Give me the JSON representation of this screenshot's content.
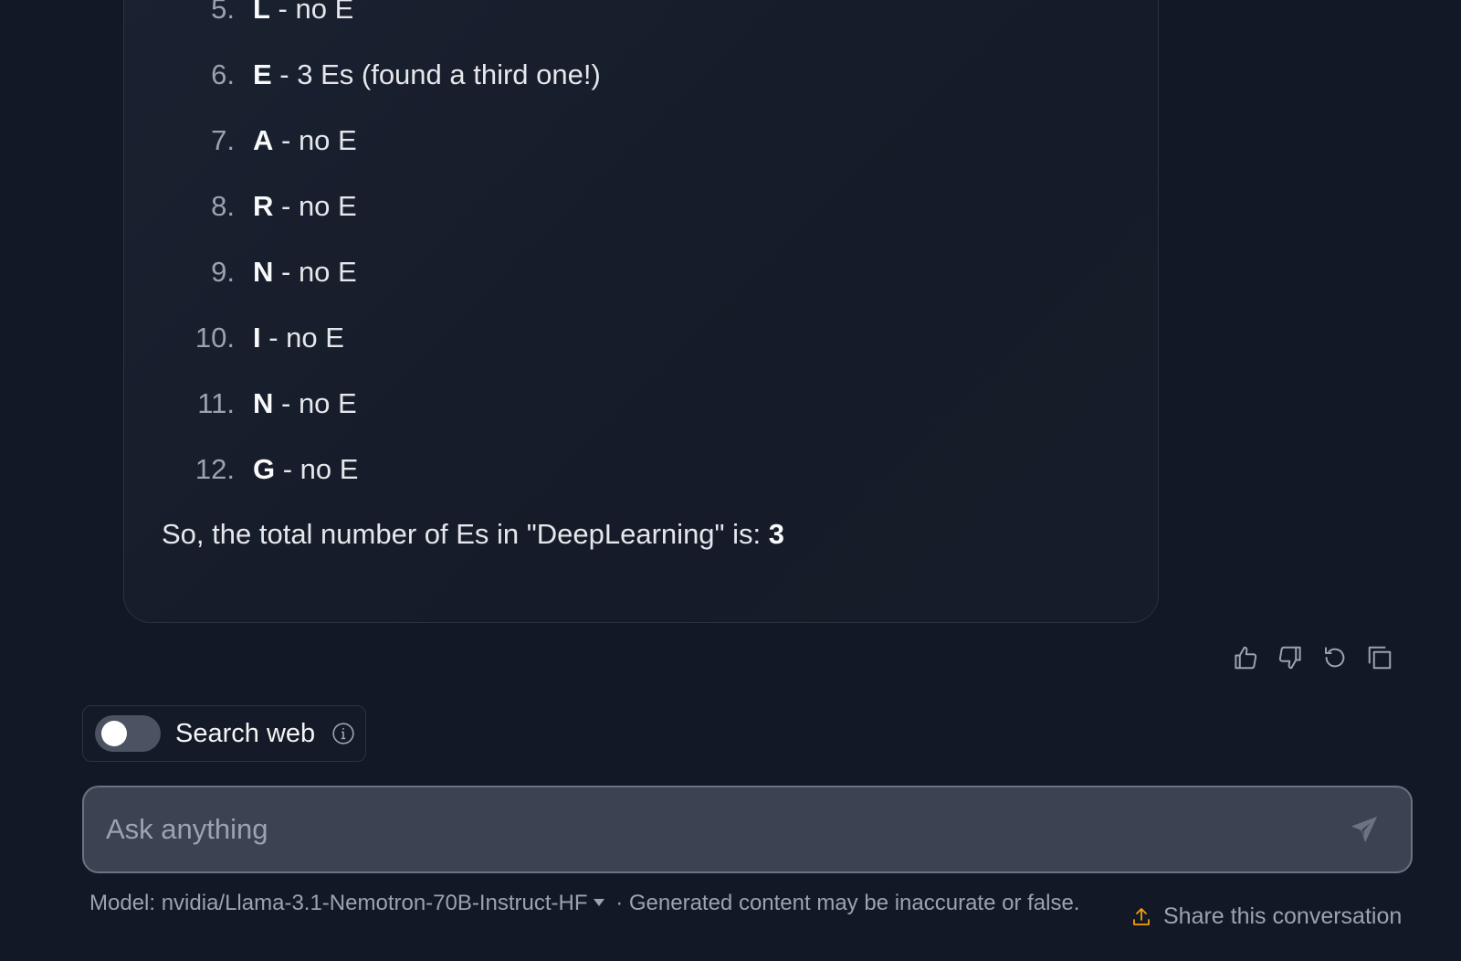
{
  "message": {
    "steps": [
      {
        "num": "5.",
        "letter": "L",
        "text": " - no E"
      },
      {
        "num": "6.",
        "letter": "E",
        "text": " - 3 Es (found a third one!)"
      },
      {
        "num": "7.",
        "letter": "A",
        "text": " - no E"
      },
      {
        "num": "8.",
        "letter": "R",
        "text": " - no E"
      },
      {
        "num": "9.",
        "letter": "N",
        "text": " - no E"
      },
      {
        "num": "10.",
        "letter": "I",
        "text": " - no E"
      },
      {
        "num": "11.",
        "letter": "N",
        "text": " - no E"
      },
      {
        "num": "12.",
        "letter": "G",
        "text": " - no E"
      }
    ],
    "summary_prefix": "So, the total number of Es in \"DeepLearning\" is: ",
    "summary_value": "3"
  },
  "actions": {
    "icons": [
      "thumbs-up-icon",
      "thumbs-down-icon",
      "retry-icon",
      "copy-icon"
    ]
  },
  "search_web": {
    "label": "Search web",
    "enabled": false
  },
  "input": {
    "placeholder": "Ask anything",
    "value": ""
  },
  "footer": {
    "model_prefix": "Model: ",
    "model_name": "nvidia/Llama-3.1-Nemotron-70B-Instruct-HF",
    "disclaimer": " · Generated content may be inaccurate or false.",
    "share_label": "Share this conversation"
  },
  "colors": {
    "background": "#121826",
    "card_border": "#2a3140",
    "input_bg": "#3b4252",
    "share_icon": "#f59e0b"
  }
}
